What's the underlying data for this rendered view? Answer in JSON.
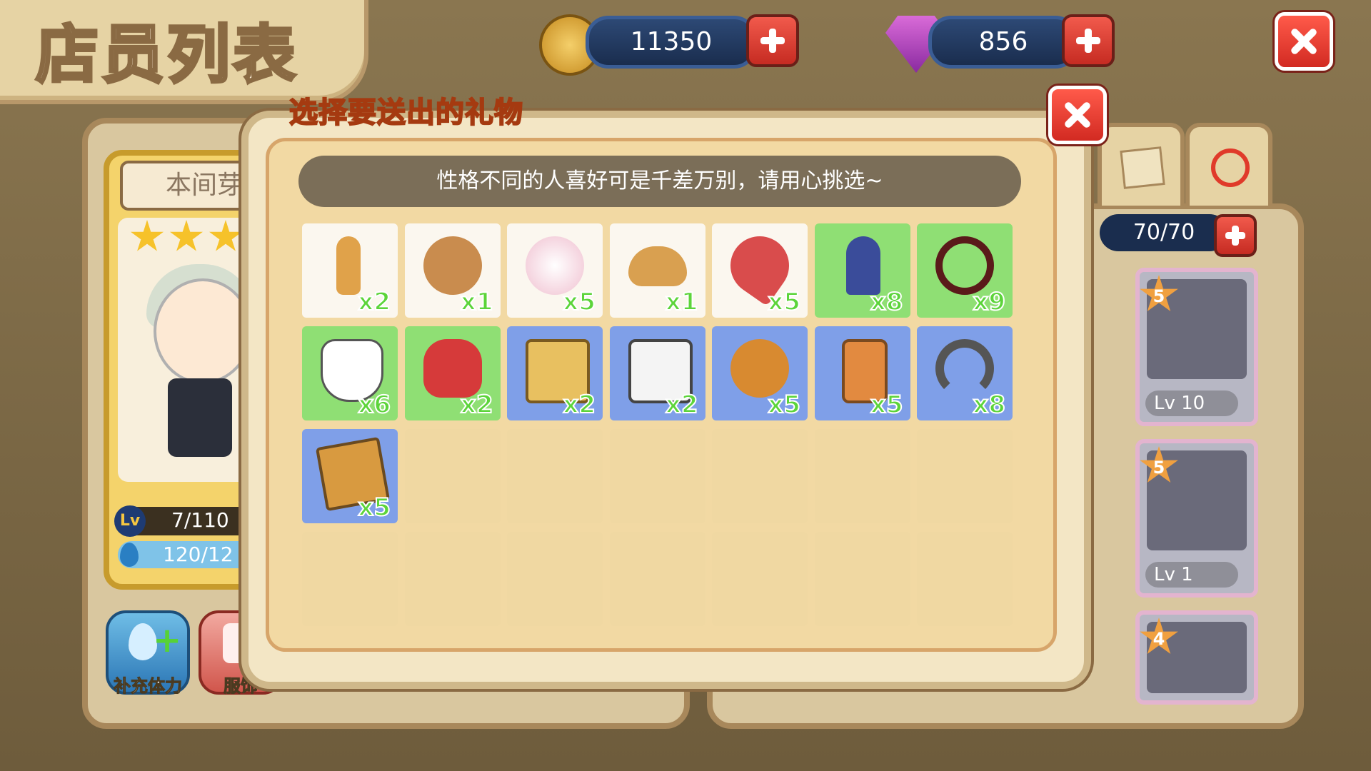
{
  "header": {
    "title": "店员列表",
    "coins": "11350",
    "gems": "856"
  },
  "character": {
    "name": "本间芽",
    "stars": 3,
    "level_text": "7/110",
    "level_badge": "Lv",
    "stamina_text": "120/12"
  },
  "left_buttons": [
    {
      "label": "补充体力",
      "icon": "stamina-plus-icon"
    },
    {
      "label": "服饰",
      "icon": "clothes-icon"
    }
  ],
  "right_panel": {
    "staff_count": "70/70",
    "cards": [
      {
        "stars": "5",
        "level": "Lv 10"
      },
      {
        "stars": "5",
        "level": "Lv 1"
      },
      {
        "stars": "4",
        "level": ""
      }
    ]
  },
  "dialog": {
    "title": "选择要送出的礼物",
    "hint": "性格不同的人喜好可是千差万别，请用心挑选~",
    "gifts": [
      {
        "name": "bottle-icon",
        "count": "x2",
        "bg": "w"
      },
      {
        "name": "teddy-bear-icon",
        "count": "x1",
        "bg": "w"
      },
      {
        "name": "bouquet-icon",
        "count": "x5",
        "bg": "w"
      },
      {
        "name": "bread-icon",
        "count": "x1",
        "bg": "w"
      },
      {
        "name": "umbrella-icon",
        "count": "x5",
        "bg": "w"
      },
      {
        "name": "figurine-icon",
        "count": "x8",
        "bg": "g"
      },
      {
        "name": "heart-bracelet-icon",
        "count": "x9",
        "bg": "g"
      },
      {
        "name": "fox-mask-icon",
        "count": "x6",
        "bg": "g"
      },
      {
        "name": "boxing-gloves-icon",
        "count": "x2",
        "bg": "g"
      },
      {
        "name": "treasure-box-icon",
        "count": "x2",
        "bg": "b"
      },
      {
        "name": "game-console-icon",
        "count": "x2",
        "bg": "b"
      },
      {
        "name": "guitar-icon",
        "count": "x5",
        "bg": "b"
      },
      {
        "name": "perfume-icon",
        "count": "x5",
        "bg": "b"
      },
      {
        "name": "headphones-icon",
        "count": "x8",
        "bg": "b"
      },
      {
        "name": "book-icon",
        "count": "x5",
        "bg": "b"
      }
    ],
    "total_slots": 28
  },
  "colors": {
    "slot_white": "#fbf7ef",
    "slot_green": "#8fdf74",
    "slot_blue": "#7f9fe8",
    "count_green": "#5cd43a"
  }
}
